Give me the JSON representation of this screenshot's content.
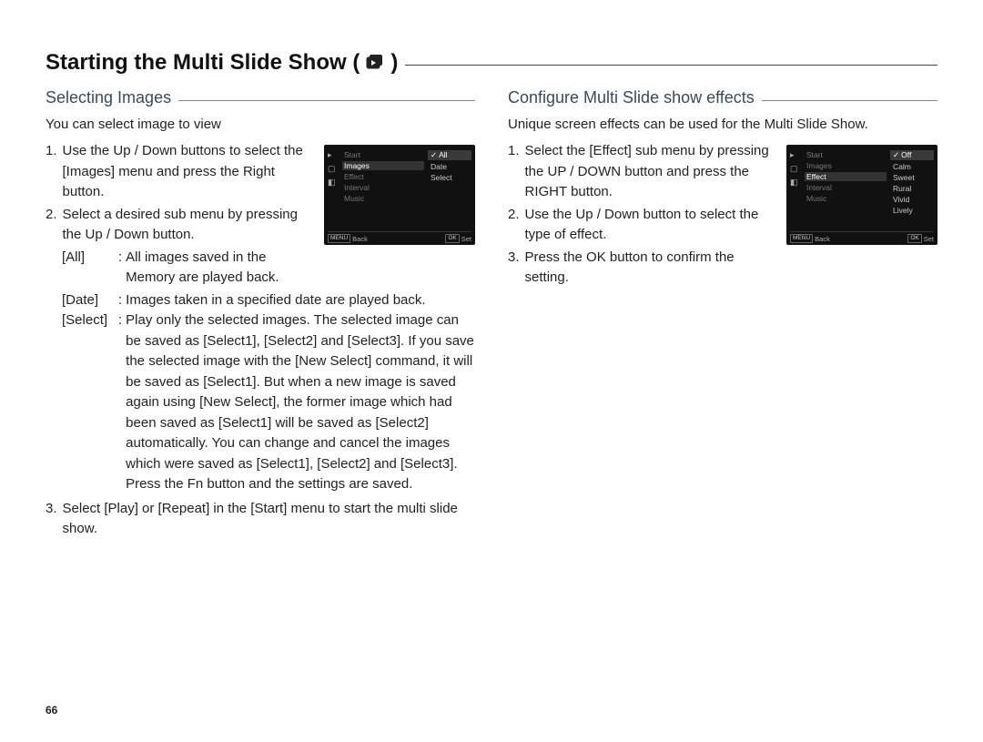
{
  "page_number": "66",
  "title": {
    "prefix": "Starting the Multi Slide Show (",
    "suffix": ")",
    "icon": "play-stack-icon"
  },
  "left": {
    "heading": "Selecting Images",
    "lead": "You can select image to view",
    "step1_num": "1.",
    "step1_txt": "Use the Up / Down buttons to select the [Images] menu and press the Right button.",
    "step2_num": "2.",
    "step2_txt": "Select a desired sub menu by pressing the Up / Down button.",
    "def_all_label": "[All]",
    "def_all_txt": "All images saved in the Memory are played back.",
    "def_date_label": "[Date]",
    "def_date_txt": "Images taken in a specified date are played back.",
    "def_select_label": "[Select]",
    "def_select_txt": "Play only the selected images. The selected image can be saved as [Select1], [Select2] and [Select3]. If you save the selected image with the [New Select] command, it will be saved as [Select1]. But when a new image is saved again using [New Select], the former image which had been saved as [Select1] will be saved as [Select2] automatically. You can change and cancel the images which were saved as [Select1], [Select2] and [Select3]. Press the Fn button and the settings are saved.",
    "step3_num": "3.",
    "step3_txt": "Select [Play] or [Repeat] in the [Start] menu to start the multi slide show.",
    "lcd": {
      "items": [
        "Start",
        "Images",
        "Effect",
        "Interval",
        "Music"
      ],
      "highlight": "Images",
      "sub": [
        "All",
        "Date",
        "Select"
      ],
      "sub_selected": "All",
      "footer_left_key": "MENU",
      "footer_left": "Back",
      "footer_right_key": "OK",
      "footer_right": "Set"
    }
  },
  "right": {
    "heading": "Configure Multi Slide show effects",
    "lead": "Unique screen effects can be used for the Multi Slide Show.",
    "step1_num": "1.",
    "step1_txt": "Select the [Effect] sub menu by pressing the UP / DOWN button and press the RIGHT button.",
    "step2_num": "2.",
    "step2_txt": "Use the Up / Down button to select the type of effect.",
    "step3_num": "3.",
    "step3_txt": "Press the OK button to confirm the setting.",
    "lcd": {
      "items": [
        "Start",
        "Images",
        "Effect",
        "Interval",
        "Music"
      ],
      "highlight": "Effect",
      "sub": [
        "Off",
        "Calm",
        "Sweet",
        "Rural",
        "Vivid",
        "Lively"
      ],
      "sub_selected": "Off",
      "footer_left_key": "MENU",
      "footer_left": "Back",
      "footer_right_key": "OK",
      "footer_right": "Set"
    }
  }
}
